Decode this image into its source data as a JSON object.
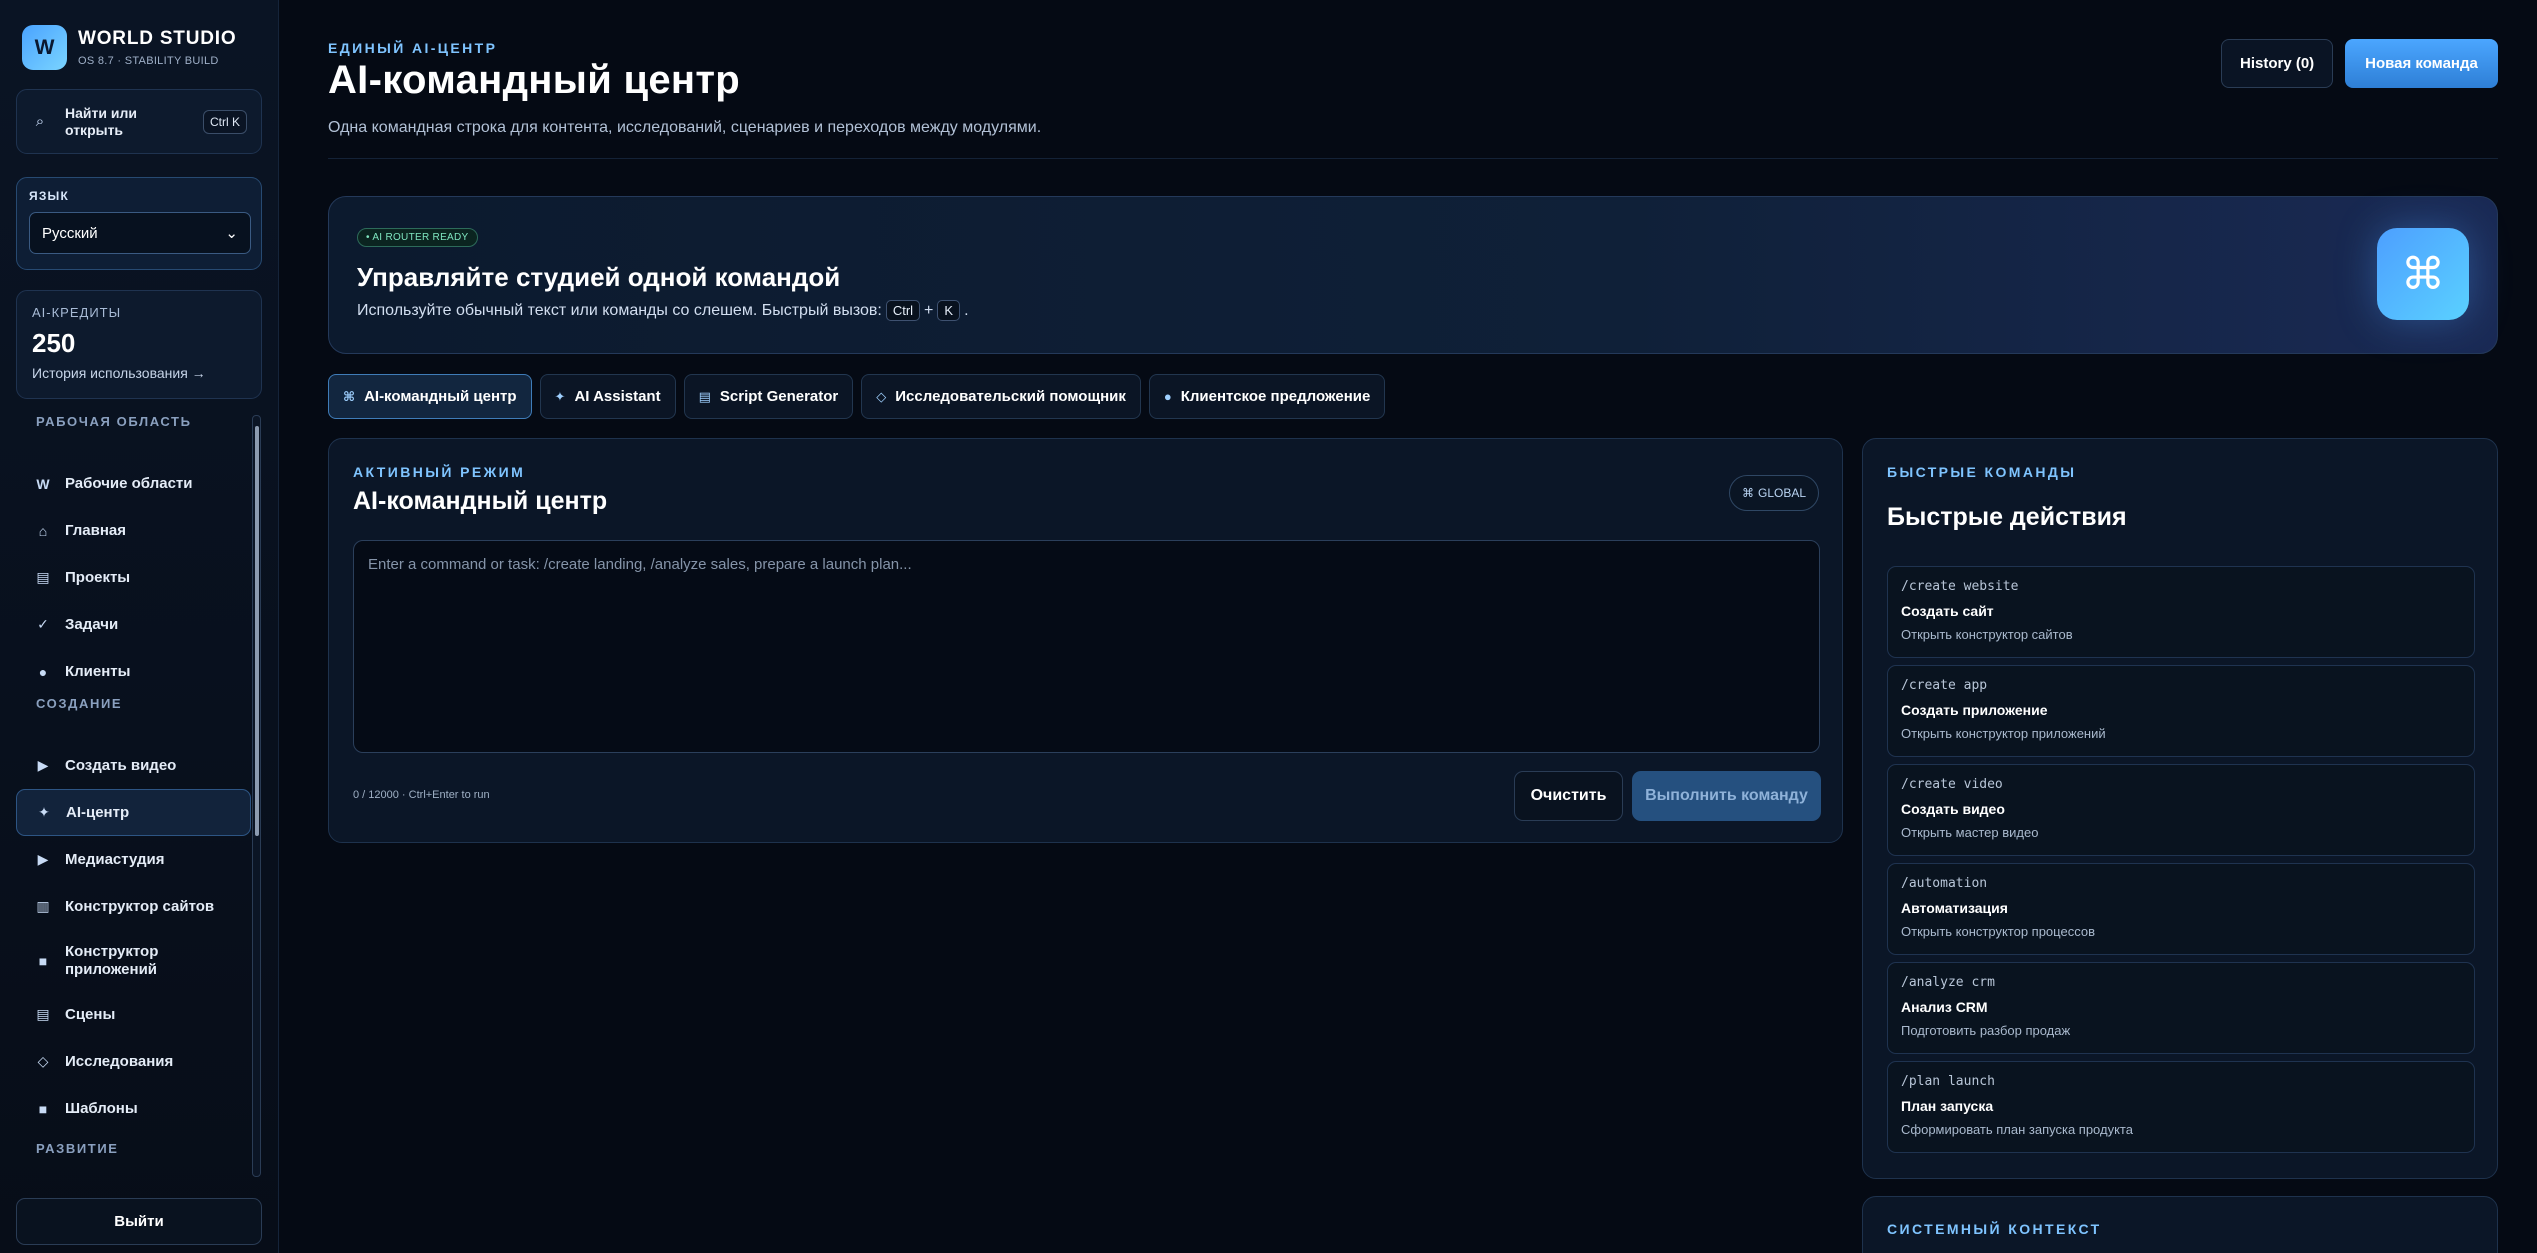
{
  "sidebar": {
    "brand": {
      "logo_letter": "W",
      "name": "WORLD STUDIO",
      "subtitle": "OS 8.7 · STABILITY BUILD"
    },
    "search": {
      "label": "Найти или открыть",
      "shortcut": "Ctrl K",
      "icon": "search-icon"
    },
    "language": {
      "title": "ЯЗЫК",
      "selected": "Русский"
    },
    "credits": {
      "title": "AI-КРЕДИТЫ",
      "value": "250",
      "link": "История использования →"
    },
    "sections": [
      {
        "title": "РАБОЧАЯ ОБЛАСТЬ",
        "items": [
          {
            "label": "Рабочие области",
            "icon": "W"
          },
          {
            "label": "Главная",
            "icon": "⌂"
          },
          {
            "label": "Проекты",
            "icon": "▤"
          },
          {
            "label": "Задачи",
            "icon": "✓"
          },
          {
            "label": "Клиенты",
            "icon": "●"
          }
        ]
      },
      {
        "title": "СОЗДАНИЕ",
        "items": [
          {
            "label": "Создать видео",
            "icon": "▶"
          },
          {
            "label": "AI-центр",
            "icon": "✦",
            "active": true
          },
          {
            "label": "Медиастудия",
            "icon": "▶"
          },
          {
            "label": "Конструктор сайтов",
            "icon": "▥"
          },
          {
            "label": "Конструктор приложений",
            "icon": "■"
          },
          {
            "label": "Сцены",
            "icon": "▤"
          },
          {
            "label": "Исследования",
            "icon": "◇"
          },
          {
            "label": "Шаблоны",
            "icon": "■"
          }
        ]
      },
      {
        "title": "РАЗВИТИЕ",
        "items": []
      }
    ],
    "logout": "Выйти"
  },
  "header": {
    "eyebrow": "ЕДИНЫЙ AI-ЦЕНТР",
    "title": "AI-командный центр",
    "description": "Одна командная строка для контента, исследований, сценариев и переходов между модулями.",
    "history_button": "History (0)",
    "new_button": "Новая команда"
  },
  "hero": {
    "badge": "• AI ROUTER READY",
    "title": "Управляйте студией одной командой",
    "desc_prefix": "Используйте обычный текст или команды со слешем. Быстрый вызов:",
    "key1": "Ctrl",
    "plus": "+",
    "key2": "K",
    "suffix": ".",
    "icon": "⌘"
  },
  "tabs": [
    {
      "label": "AI-командный центр",
      "icon": "⌘",
      "active": true
    },
    {
      "label": "AI Assistant",
      "icon": "✦"
    },
    {
      "label": "Script Generator",
      "icon": "▤"
    },
    {
      "label": "Исследовательский помощник",
      "icon": "◇"
    },
    {
      "label": "Клиентское предложение",
      "icon": "●"
    }
  ],
  "panel": {
    "eyebrow": "АКТИВНЫЙ РЕЖИМ",
    "title": "AI-командный центр",
    "scope": "GLOBAL",
    "scope_icon": "⌘",
    "placeholder": "Enter a command or task: /create landing, /analyze sales, prepare a launch plan...",
    "counter": "0 / 12000 · Ctrl+Enter to run",
    "clear": "Очистить",
    "run": "Выполнить команду"
  },
  "quick": {
    "eyebrow": "БЫСТРЫЕ КОМАНДЫ",
    "title": "Быстрые действия",
    "items": [
      {
        "cmd": "/create website",
        "name": "Создать сайт",
        "desc": "Открыть конструктор сайтов"
      },
      {
        "cmd": "/create app",
        "name": "Создать приложение",
        "desc": "Открыть конструктор приложений"
      },
      {
        "cmd": "/create video",
        "name": "Создать видео",
        "desc": "Открыть мастер видео"
      },
      {
        "cmd": "/automation",
        "name": "Автоматизация",
        "desc": "Открыть конструктор процессов"
      },
      {
        "cmd": "/analyze crm",
        "name": "Анализ CRM",
        "desc": "Подготовить разбор продаж"
      },
      {
        "cmd": "/plan launch",
        "name": "План запуска",
        "desc": "Сформировать план запуска продукта"
      }
    ]
  },
  "context": {
    "eyebrow": "СИСТЕМНЫЙ КОНТЕКСТ"
  },
  "colors": {
    "accent": "#4ba6ff",
    "bg": "#050a14",
    "panel": "#0b1627"
  }
}
